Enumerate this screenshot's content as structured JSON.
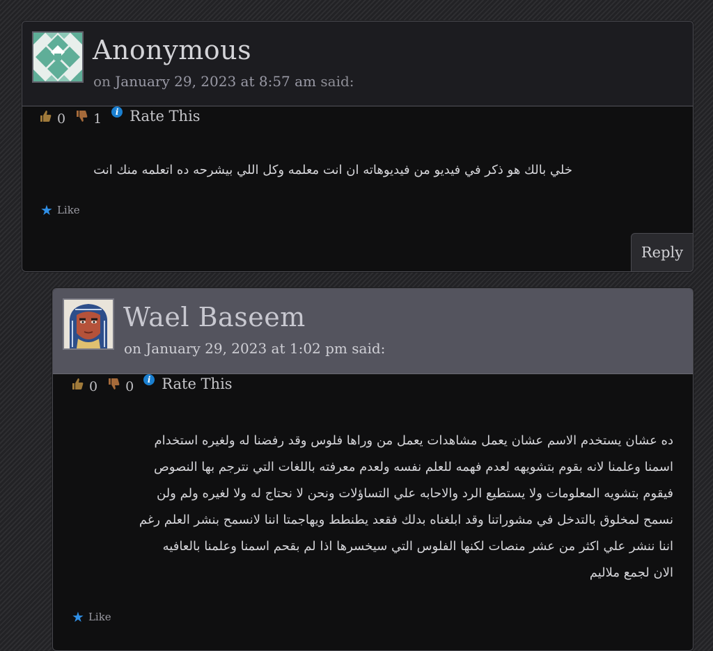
{
  "comments": [
    {
      "author": "Anonymous",
      "meta_prefix": "on",
      "date": "January 29, 2023 at 8:57 am",
      "meta_suffix": "said:",
      "thumbs_up_count": "0",
      "thumbs_down_count": "1",
      "rate_label": "Rate This",
      "body": "خلي بالك هو ذكر في فيديو من فيديوهاته ان انت معلمه وكل اللي بيشرحه ده اتعلمه منك انت",
      "like_label": "Like",
      "reply_label": "Reply",
      "avatar": "geometric-identicon"
    },
    {
      "author": "Wael Baseem",
      "meta_prefix": "on",
      "date": "January 29, 2023 at 1:02 pm",
      "meta_suffix": "said:",
      "thumbs_up_count": "0",
      "thumbs_down_count": "0",
      "rate_label": "Rate This",
      "body_lines": [
        "ده عشان يستخدم الاسم عشان يعمل مشاهدات يعمل من وراها فلوس وقد رفضنا له ولغيره استخدام",
        "اسمنا وعلمنا لانه بقوم بتشويهه لعدم فهمه للعلم نفسه ولعدم معرفته باللغات التي نترجم بها النصوص",
        "فيقوم بتشويه المعلومات ولا يستطيع الرد والاحابه علي التساؤلات ونحن لا نحتاج له ولا لغيره ولم ولن",
        "نسمح لمخلوق بالتدخل في مشوراتنا وقد ابلغناه بدلك فقعد يطنطط ويهاجمتا اننا لانسمح بنشر العلم رغم",
        "اننا ننشر علي اكثر من عشر منصات لكنها الفلوس التي سيخسرها اذا لم بقحم اسمنا وعلمنا بالعافيه",
        "الان لجمع ملاليم"
      ],
      "like_label": "Like",
      "avatar": "pharaoh-mask"
    }
  ],
  "colors": {
    "accent_star": "#2f8fe6",
    "info_icon": "#1a7fd0",
    "card_bg": "#0f0f10",
    "header_reply_bg": "#54545e"
  }
}
